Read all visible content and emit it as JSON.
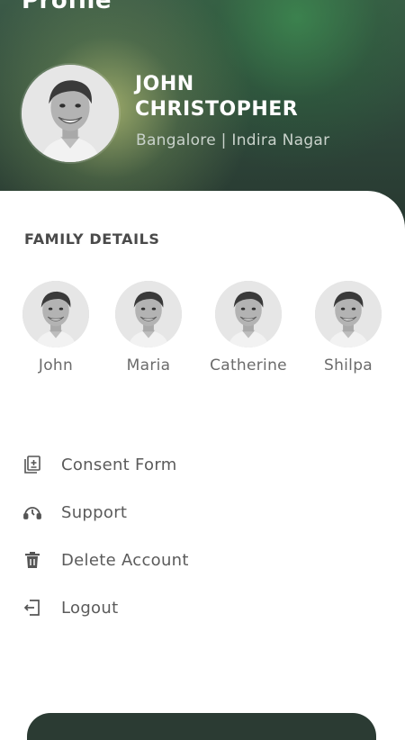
{
  "header": {
    "title": "Profile",
    "user": {
      "name_line1": "JOHN",
      "name_line2": "CHRISTOPHER",
      "location": "Bangalore | Indira Nagar"
    }
  },
  "family": {
    "title": "FAMILY DETAILS",
    "members": [
      {
        "name": "John"
      },
      {
        "name": "Maria"
      },
      {
        "name": "Catherine"
      },
      {
        "name": "Shilpa"
      }
    ]
  },
  "menu": {
    "items": [
      {
        "label": "Consent Form",
        "icon": "consent-form-icon"
      },
      {
        "label": "Support",
        "icon": "support-icon"
      },
      {
        "label": "Delete Account",
        "icon": "trash-icon"
      },
      {
        "label": "Logout",
        "icon": "logout-icon"
      }
    ]
  },
  "colors": {
    "header_dark": "#27372f",
    "header_green": "#3b5a47",
    "text_gray": "#5b5b5b",
    "bottom_button": "#2b3b33"
  }
}
